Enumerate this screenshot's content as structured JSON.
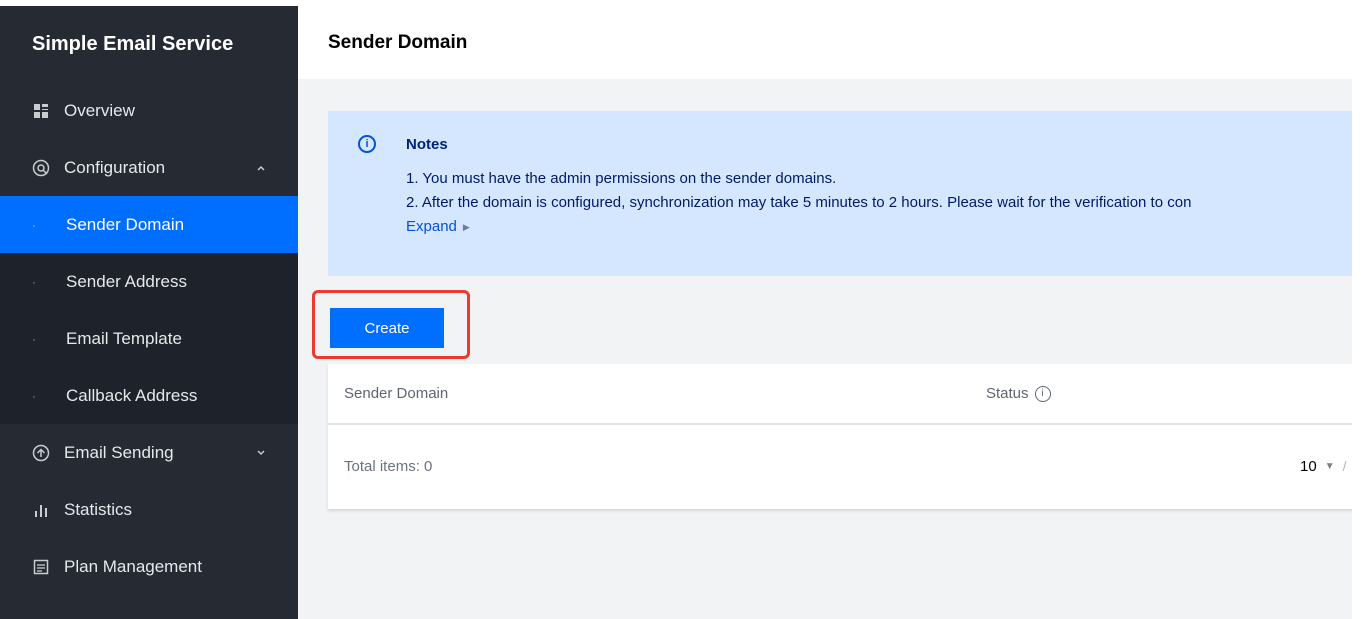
{
  "sidebar": {
    "title": "Simple Email Service",
    "items": [
      {
        "label": "Overview",
        "icon": "grid-icon"
      },
      {
        "label": "Configuration",
        "icon": "configuration-icon",
        "caret": "^"
      },
      {
        "label": "Email Sending",
        "icon": "email-sending-icon",
        "caret": "v"
      },
      {
        "label": "Statistics",
        "icon": "bar-chart-icon"
      },
      {
        "label": "Plan Management",
        "icon": "plan-icon"
      }
    ],
    "submenu": [
      {
        "label": "Sender Domain",
        "active": true
      },
      {
        "label": "Sender Address"
      },
      {
        "label": "Email Template"
      },
      {
        "label": "Callback Address"
      }
    ]
  },
  "header": {
    "title": "Sender Domain"
  },
  "notes": {
    "title": "Notes",
    "line1": "1. You must have the admin permissions on the sender domains.",
    "line2": "2. After the domain is configured, synchronization may take 5 minutes to 2 hours. Please wait for the verification to con",
    "expand": "Expand"
  },
  "toolbar": {
    "create_label": "Create"
  },
  "table": {
    "columns": [
      "Sender Domain",
      "Status"
    ],
    "total": "Total items: 0",
    "page_size": "10"
  },
  "colors": {
    "sidebar_bg": "#252a33",
    "accent": "#006eff",
    "notes_bg": "#d5e7ff",
    "highlight": "#ec3a2d"
  }
}
